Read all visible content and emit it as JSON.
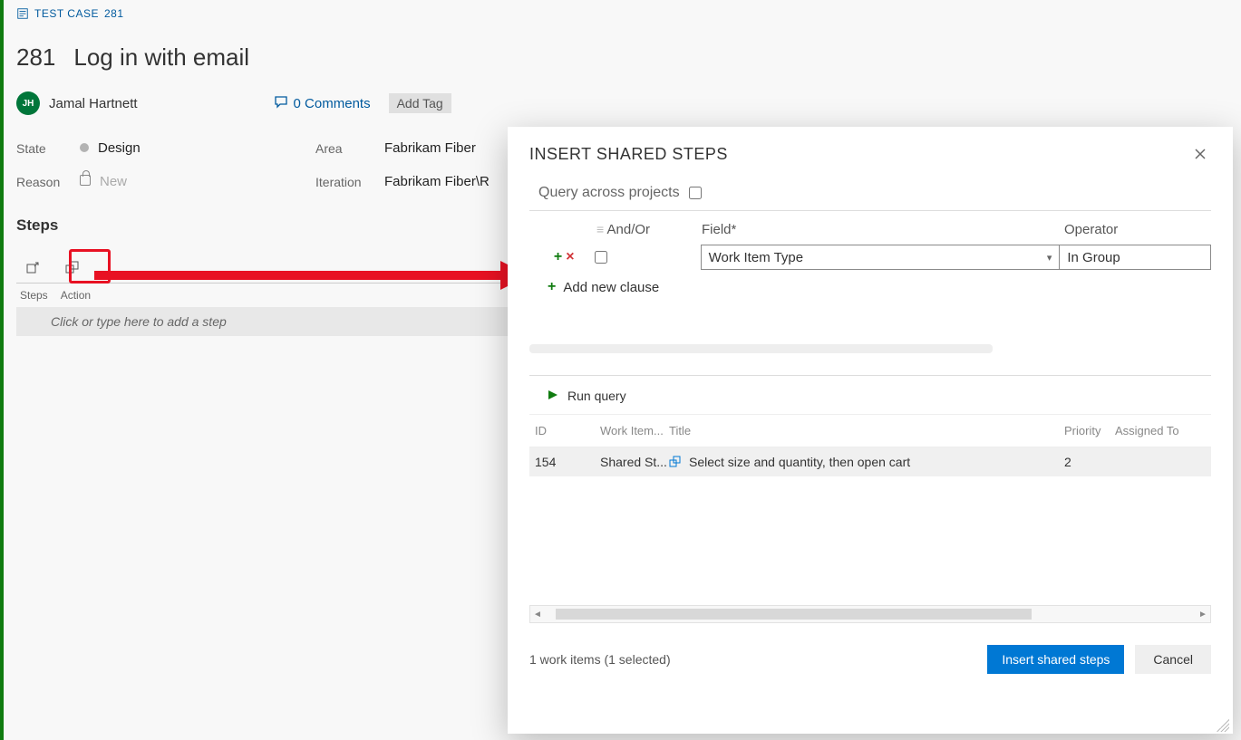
{
  "breadcrumb": {
    "type_label": "TEST CASE",
    "id": "281"
  },
  "title": {
    "id": "281",
    "text": "Log in with email"
  },
  "assignee": {
    "initials": "JH",
    "name": "Jamal Hartnett"
  },
  "comments": {
    "label": "0 Comments"
  },
  "tags": {
    "add_label": "Add Tag"
  },
  "fields": {
    "state_label": "State",
    "state_value": "Design",
    "reason_label": "Reason",
    "reason_value": "New",
    "area_label": "Area",
    "area_value": "Fabrikam Fiber",
    "iteration_label": "Iteration",
    "iteration_value": "Fabrikam Fiber\\R"
  },
  "steps": {
    "header": "Steps",
    "columns": {
      "steps": "Steps",
      "action": "Action"
    },
    "placeholder": "Click or type here to add a step"
  },
  "dialog": {
    "title": "INSERT SHARED STEPS",
    "query_across_label": "Query across projects",
    "clause_headers": {
      "andor": "And/Or",
      "field": "Field*",
      "operator": "Operator"
    },
    "clause": {
      "field_value": "Work Item Type",
      "operator_value": "In Group"
    },
    "add_clause_label": "Add new clause",
    "run_query_label": "Run query",
    "results_columns": {
      "id": "ID",
      "type": "Work Item...",
      "title": "Title",
      "priority": "Priority",
      "assigned": "Assigned To"
    },
    "results_row": {
      "id": "154",
      "type": "Shared St...",
      "title": "Select size and quantity, then open cart",
      "priority": "2",
      "assigned": ""
    },
    "footer_status": "1 work items (1 selected)",
    "insert_label": "Insert shared steps",
    "cancel_label": "Cancel"
  }
}
